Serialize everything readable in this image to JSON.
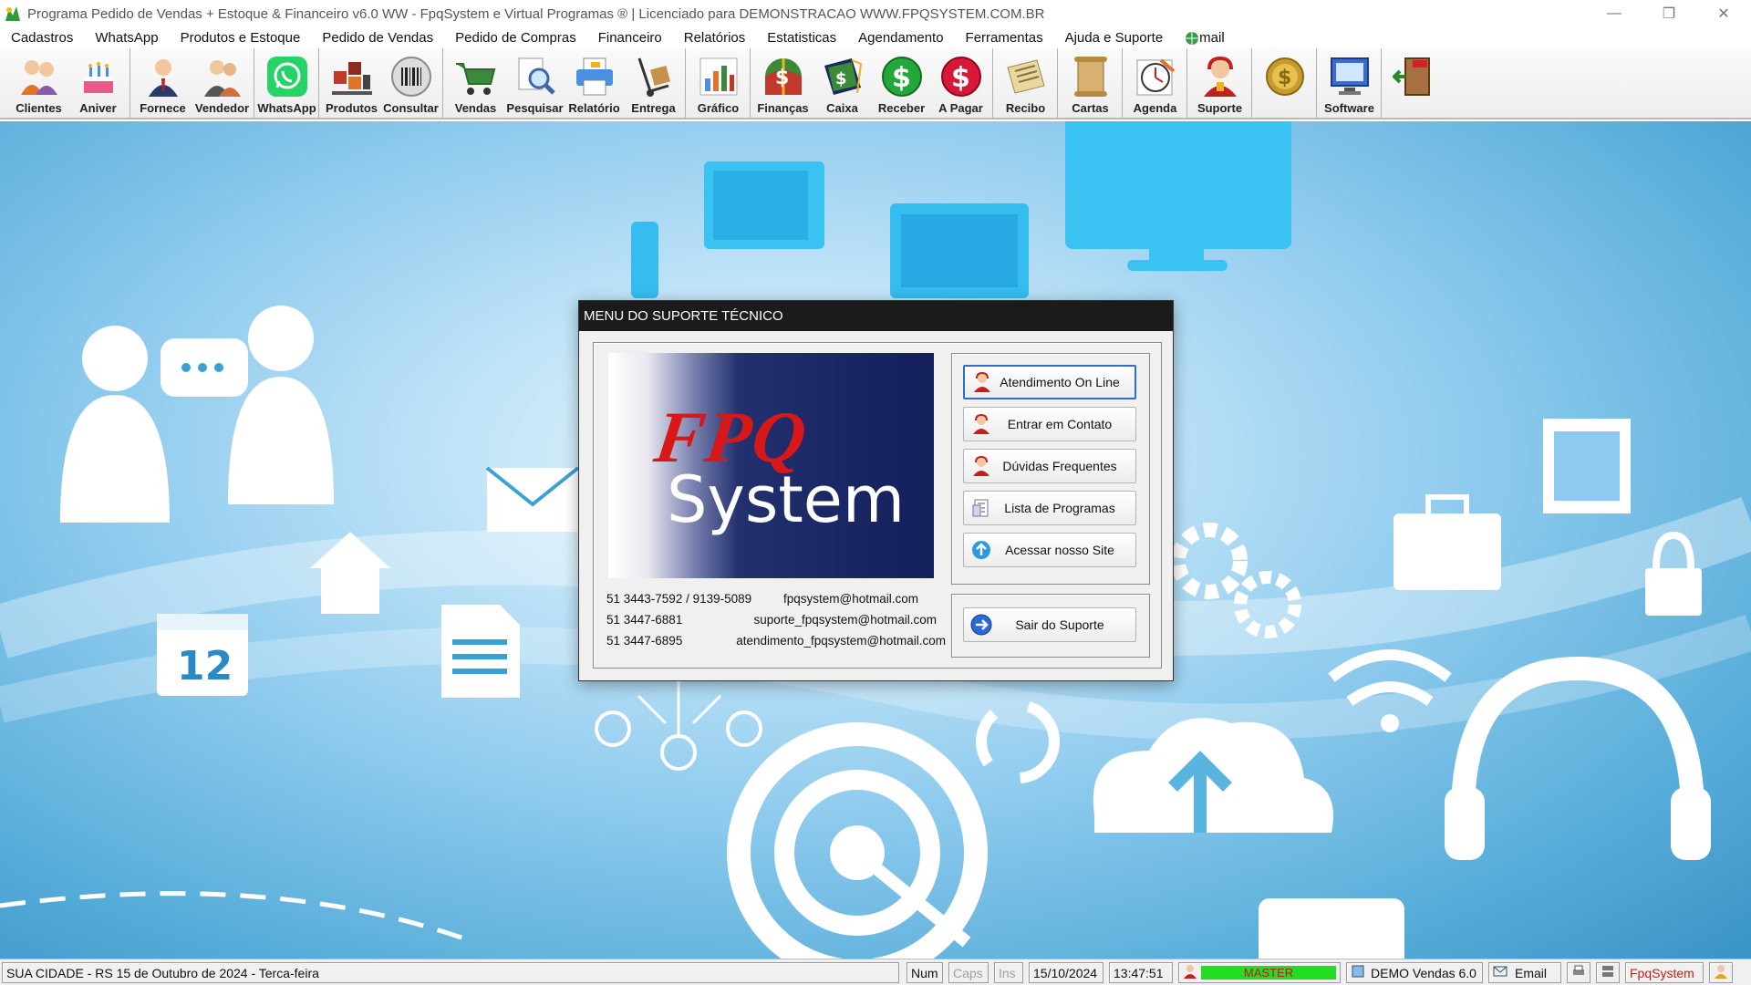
{
  "window": {
    "title": "Programa Pedido de Vendas + Estoque & Financeiro v6.0 WW - FpqSystem e Virtual Programas ® | Licenciado para  DEMONSTRACAO WWW.FPQSYSTEM.COM.BR"
  },
  "menu": [
    {
      "label": "Cadastros"
    },
    {
      "label": "WhatsApp"
    },
    {
      "label": "Produtos e Estoque"
    },
    {
      "label": "Pedido de Vendas"
    },
    {
      "label": "Pedido de Compras"
    },
    {
      "label": "Financeiro"
    },
    {
      "label": "Relatórios"
    },
    {
      "label": "Estatisticas"
    },
    {
      "label": "Agendamento"
    },
    {
      "label": "Ferramentas"
    },
    {
      "label": "Ajuda e Suporte"
    },
    {
      "label": "mail"
    }
  ],
  "toolbar": {
    "clientes": "Clientes",
    "aniver": "Aniver",
    "fornece": "Fornece",
    "vendedor": "Vendedor",
    "whatsapp": "WhatsApp",
    "produtos": "Produtos",
    "consultar": "Consultar",
    "vendas": "Vendas",
    "pesquisar": "Pesquisar",
    "relatorio": "Relatório",
    "entrega": "Entrega",
    "grafico": "Gráfico",
    "financas": "Finanças",
    "caixa": "Caixa",
    "receber": "Receber",
    "apagar": "A Pagar",
    "recibo": "Recibo",
    "cartas": "Cartas",
    "agenda": "Agenda",
    "suporte": "Suporte",
    "software": "Software"
  },
  "desktop": {
    "calendar_day": "12"
  },
  "dialog": {
    "title": "MENU DO SUPORTE TÉCNICO",
    "logo_top": "FPQ",
    "logo_bottom": "System",
    "contacts": [
      {
        "phone": "51 3443-7592 / 9139-5089",
        "email": "fpqsystem@hotmail.com"
      },
      {
        "phone": "51 3447-6881",
        "email": "suporte_fpqsystem@hotmail.com"
      },
      {
        "phone": "51 3447-6895",
        "email": "atendimento_fpqsystem@hotmail.com"
      }
    ],
    "buttons": {
      "online": "Atendimento On Line",
      "contato": "Entrar em Contato",
      "duvidas": "Dúvidas Frequentes",
      "lista": "Lista de Programas",
      "site": "Acessar nosso Site",
      "sair": "Sair do Suporte"
    }
  },
  "status": {
    "location_date": "SUA CIDADE - RS 15 de Outubro de 2024 - Terca-feira",
    "num": "Num",
    "caps": "Caps",
    "ins": "Ins",
    "date": "15/10/2024",
    "time": "13:47:51",
    "user": "MASTER",
    "version": "DEMO Vendas 6.0",
    "email": "Email",
    "brand": "FpqSystem"
  },
  "colors": {
    "accent_blue": "#2a6fd6",
    "logo_red": "#d81818",
    "logo_navy": "#141f5c",
    "status_green": "#22dd22"
  }
}
